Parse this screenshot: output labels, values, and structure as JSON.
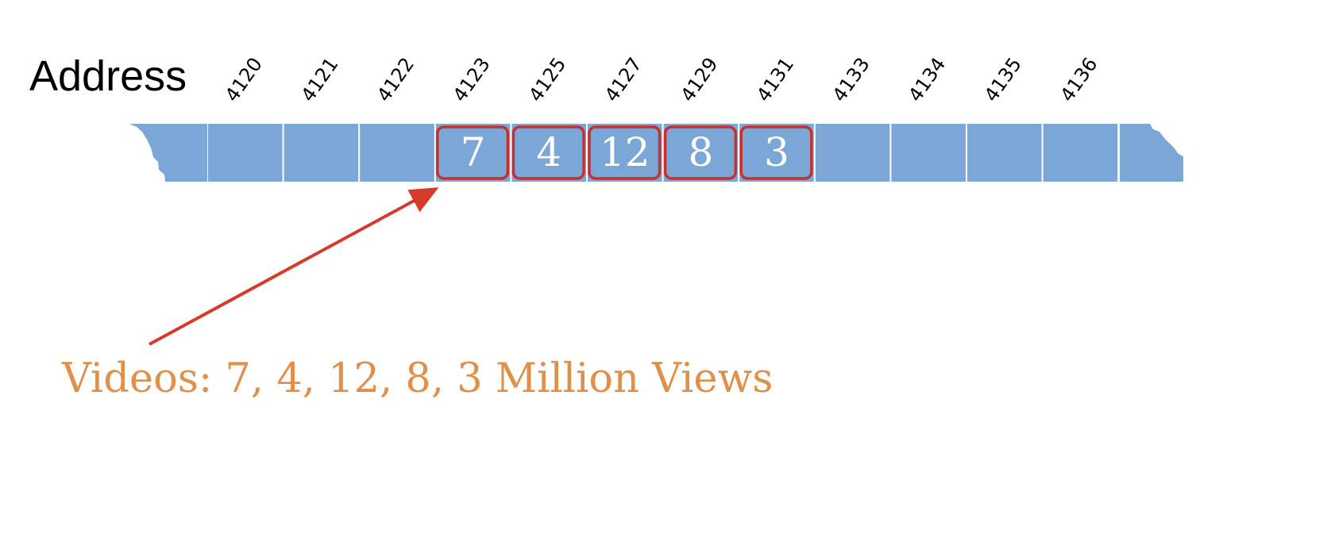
{
  "title": "Address",
  "memory": {
    "addresses": [
      "4120",
      "4121",
      "4122",
      "4123",
      "4125",
      "4127",
      "4129",
      "4131",
      "4133",
      "4134",
      "4135",
      "4136"
    ],
    "values": [
      "",
      "",
      "",
      "7",
      "4",
      "12",
      "8",
      "3",
      "",
      "",
      "",
      ""
    ],
    "highlighted": [
      false,
      false,
      false,
      true,
      true,
      true,
      true,
      true,
      false,
      false,
      false,
      false
    ]
  },
  "caption": "Videos: 7, 4, 12, 8, 3 Million Views",
  "colors": {
    "cell_fill": "#7ba7d7",
    "cell_divider": "#ffffff",
    "highlight_border": "#c9302c",
    "arrow": "#d63a2a",
    "caption": "#e0904a",
    "text": "#000000"
  }
}
